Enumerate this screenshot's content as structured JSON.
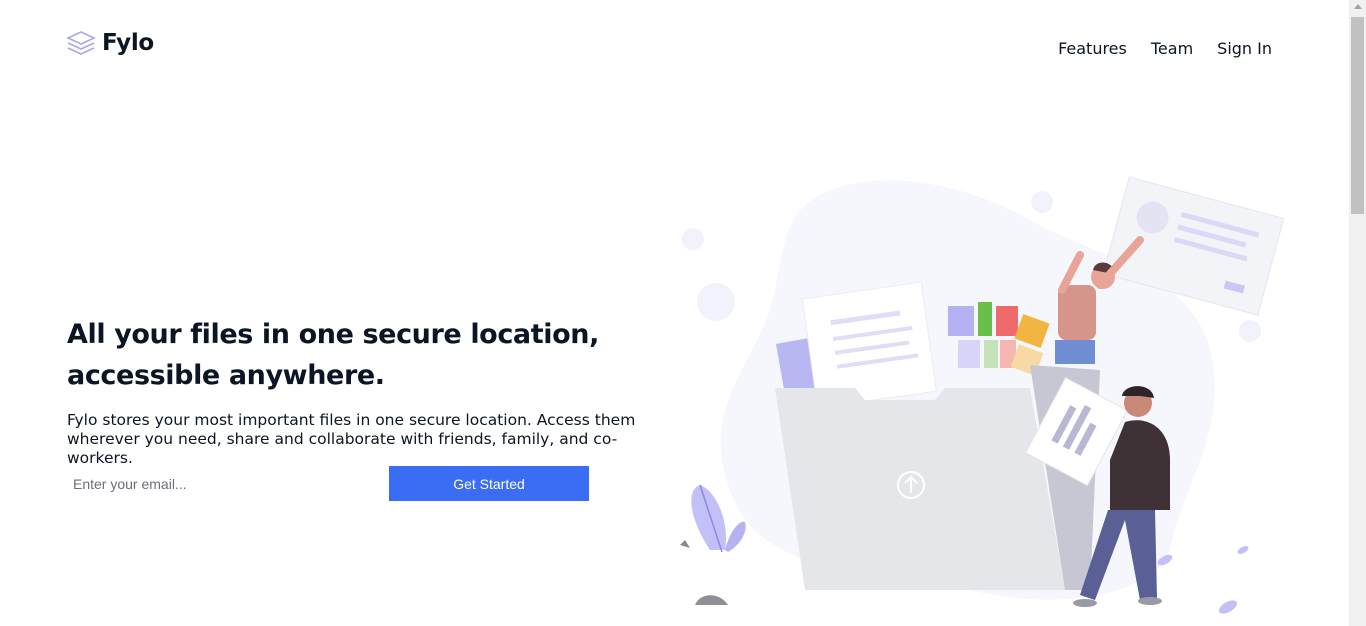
{
  "brand": {
    "name": "Fylo",
    "logo_icon": "layers-icon"
  },
  "nav": {
    "items": [
      {
        "label": "Features"
      },
      {
        "label": "Team"
      },
      {
        "label": "Sign In"
      }
    ]
  },
  "hero": {
    "title": "All your files in one secure location, accessible anywhere.",
    "text": "Fylo stores your most important files in one secure location. Access them wherever you need, share and collaborate with friends, family, and co-workers.",
    "email_placeholder": "Enter your email...",
    "cta_label": "Get Started",
    "illustration_icon": "upload-arrow-icon"
  },
  "colors": {
    "accent": "#3a6cf4",
    "text": "#0c1524",
    "illustration_purple": "#b5b2f4"
  }
}
